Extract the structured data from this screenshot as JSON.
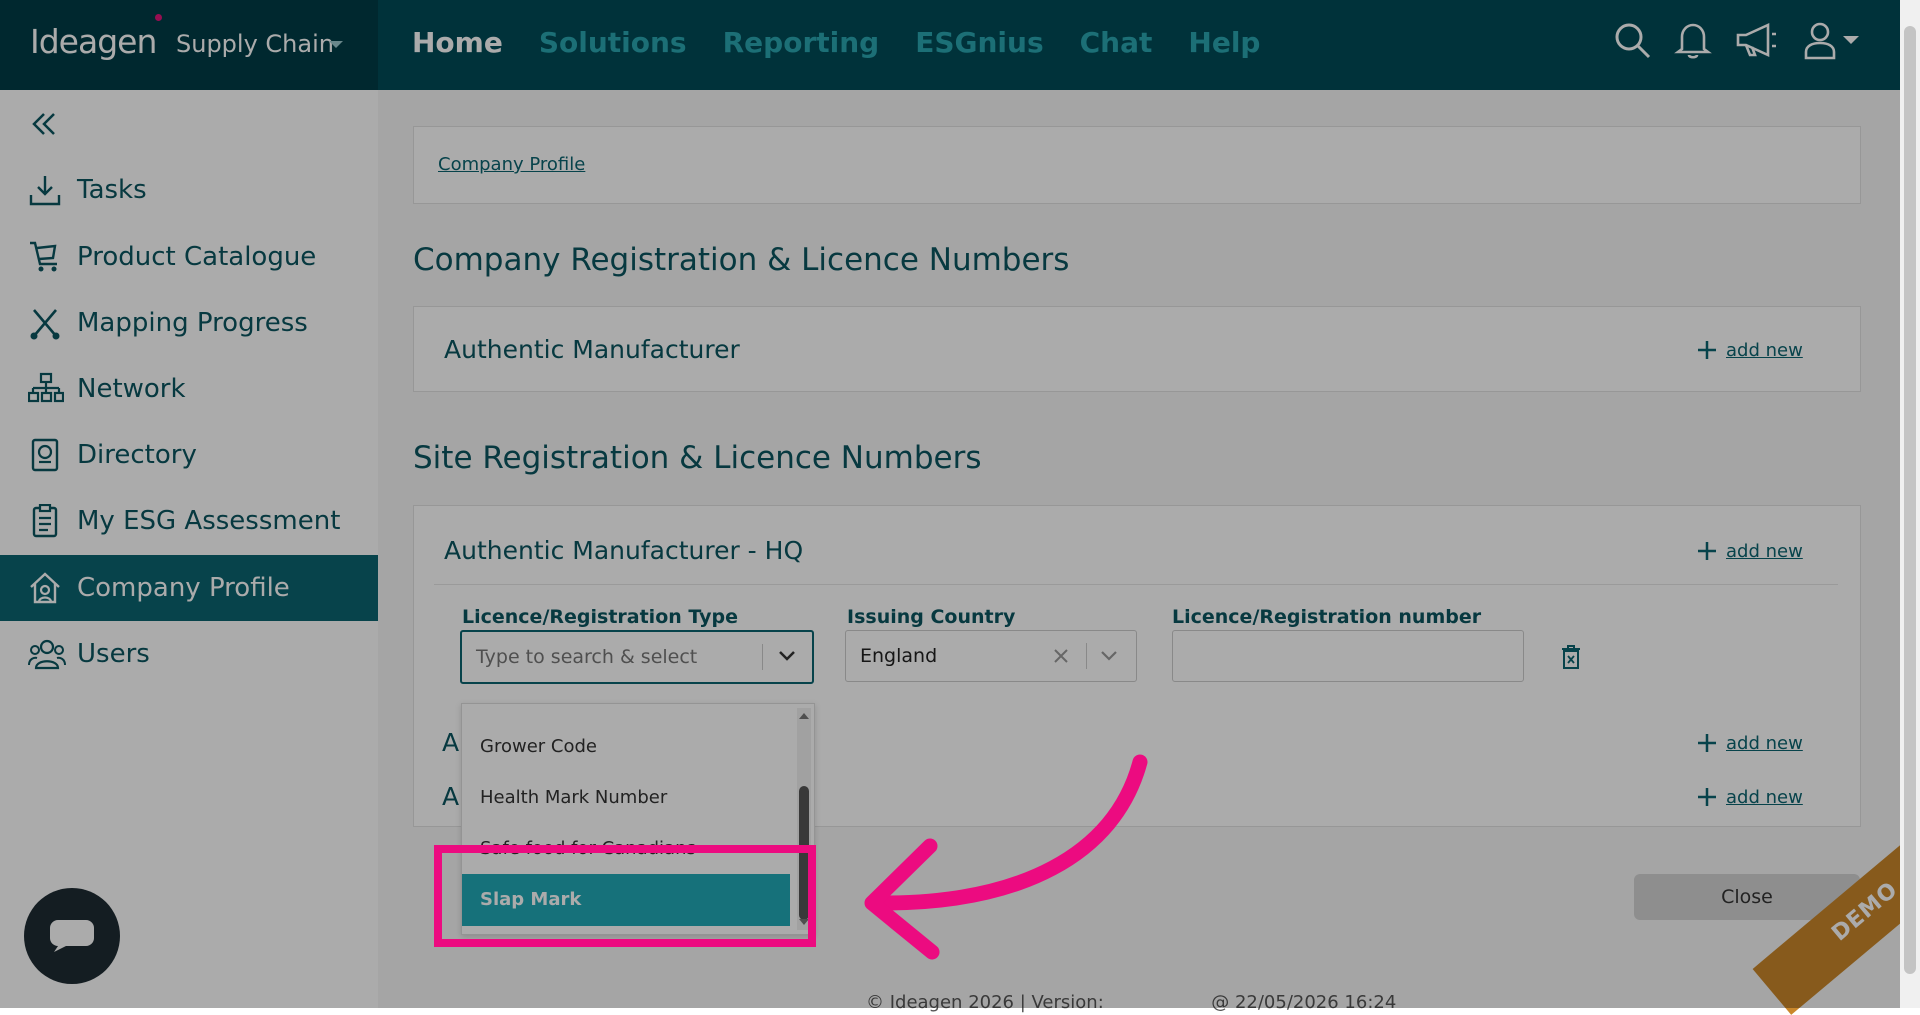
{
  "brand": {
    "logo": "Ideagen",
    "product": "Supply Chain"
  },
  "nav": {
    "items": [
      "Home",
      "Solutions",
      "Reporting",
      "ESGnius",
      "Chat",
      "Help"
    ]
  },
  "sidebar": {
    "items": [
      "Tasks",
      "Product Catalogue",
      "Mapping Progress",
      "Network",
      "Directory",
      "My ESG Assessment",
      "Company Profile",
      "Users"
    ],
    "active": "Company Profile"
  },
  "breadcrumb": "Company Profile",
  "company_section": {
    "title": "Company Registration & Licence Numbers",
    "card_title": "Authentic Manufacturer",
    "add_new": "add new"
  },
  "site_section": {
    "title": "Site Registration & Licence Numbers",
    "card_title": "Authentic Manufacturer - HQ",
    "add_new": "add new",
    "hidden_row_initial": "A",
    "columns": {
      "type": "Licence/Registration Type",
      "country": "Issuing Country",
      "number": "Licence/Registration number"
    },
    "type_placeholder": "Type to search & select",
    "country_value": "England"
  },
  "dropdown": {
    "options": [
      "Grower Code",
      "Health Mark Number",
      "Safe food for Canadians",
      "Slap Mark"
    ],
    "highlighted": "Slap Mark"
  },
  "close_label": "Close",
  "footer": {
    "left": "© Ideagen 2026 | Version:",
    "right": "@ 22/05/2026 16:24"
  },
  "demo_label": "DEMO",
  "colors": {
    "topbar": "#004b57",
    "accent": "#0b6470",
    "highlight": "#ec0b80",
    "option_selected": "#22a9b6"
  }
}
